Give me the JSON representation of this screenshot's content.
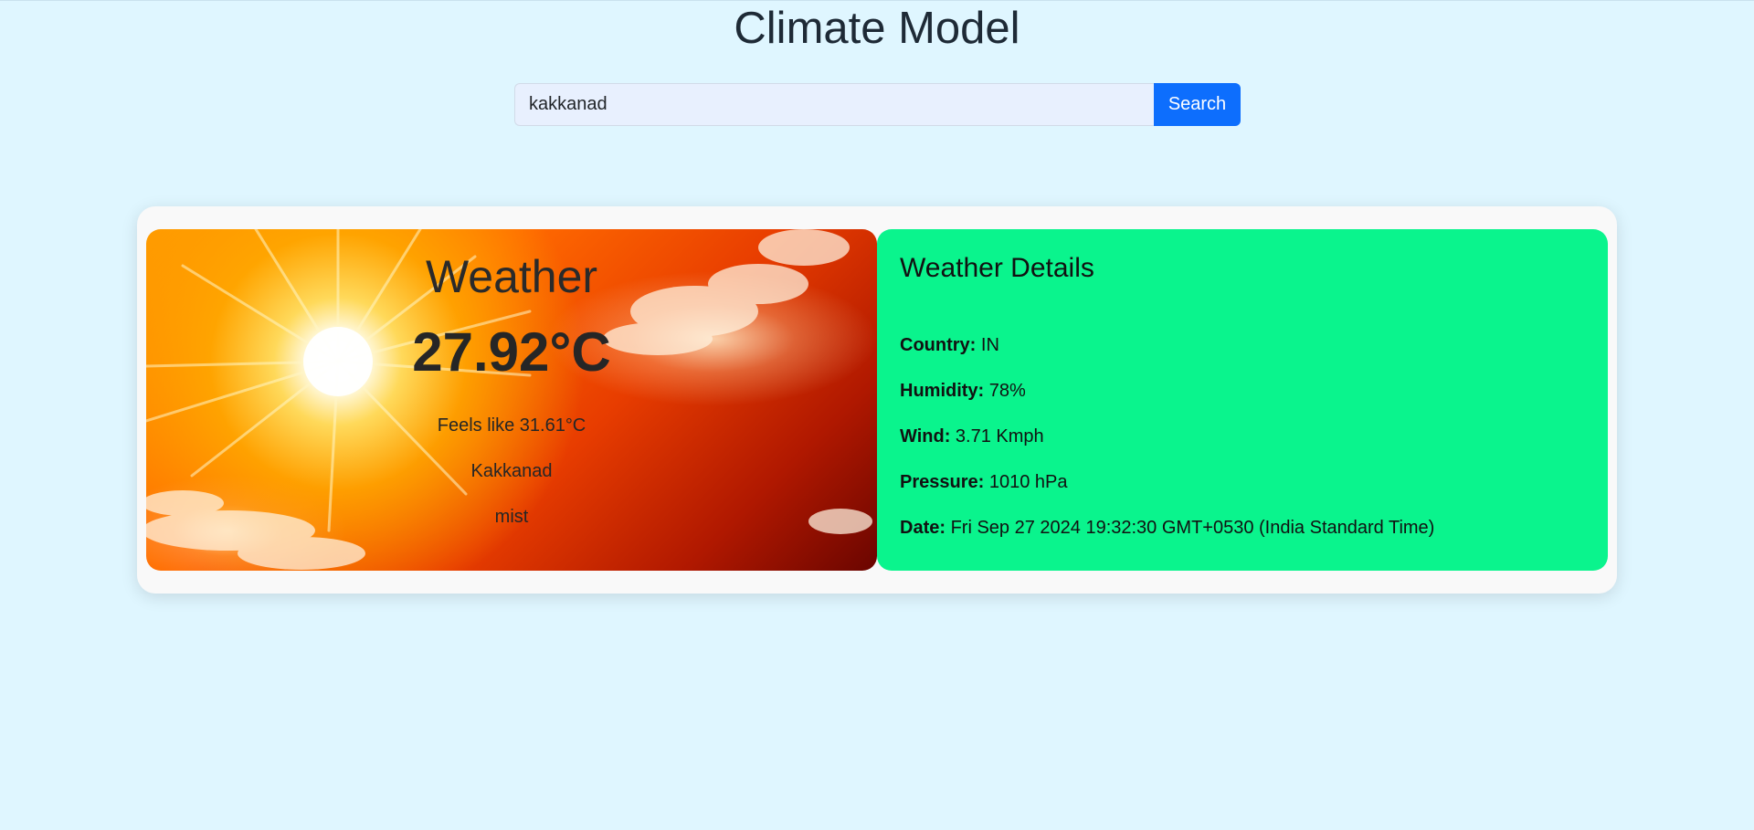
{
  "page": {
    "title": "Climate Model"
  },
  "search": {
    "value": "kakkanad",
    "button_label": "Search"
  },
  "weather": {
    "heading": "Weather",
    "temperature": "27.92°C",
    "feels_like": "Feels like 31.61°C",
    "city": "Kakkanad",
    "description": "mist",
    "background_image": "sun-icon"
  },
  "details": {
    "heading": "Weather Details",
    "rows": [
      {
        "label": "Country:",
        "value": "IN"
      },
      {
        "label": "Humidity:",
        "value": "78%"
      },
      {
        "label": "Wind:",
        "value": "3.71 Kmph"
      },
      {
        "label": "Pressure:",
        "value": "1010 hPa"
      },
      {
        "label": "Date:",
        "value": "Fri Sep 27 2024 19:32:30 GMT+0530 (India Standard Time)"
      }
    ]
  },
  "colors": {
    "background": "#dff6ff",
    "search_button": "#0d6efd",
    "details_card": "#0af48d",
    "panel": "#f9f9f9"
  }
}
